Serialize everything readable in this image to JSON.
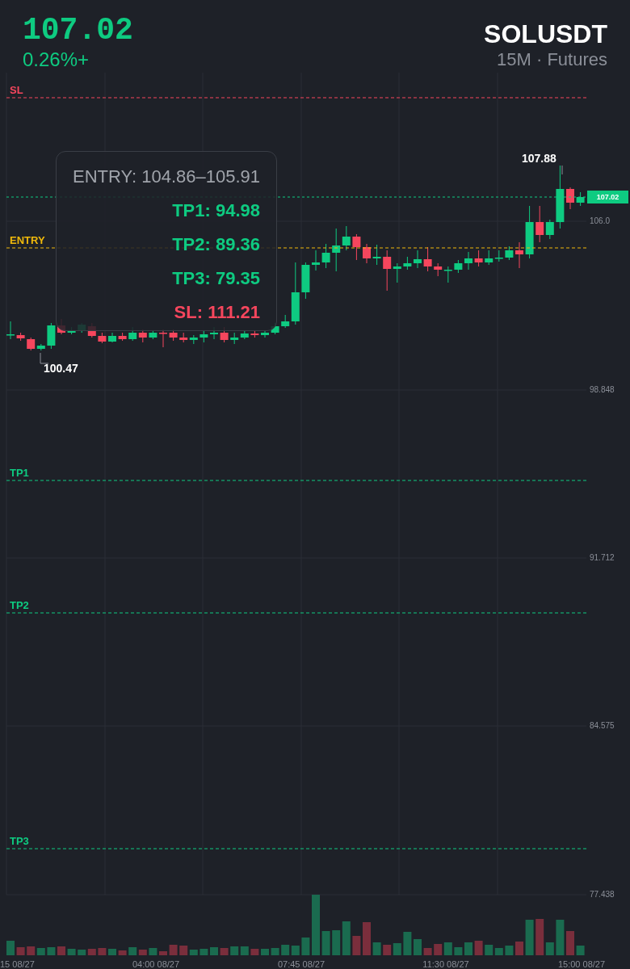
{
  "header": {
    "price": "107.02",
    "change": "0.26%+",
    "symbol": "SOLUSDT",
    "timeframe": "15M · Futures"
  },
  "levels": [
    {
      "label": "SL",
      "kind": "sl"
    },
    {
      "label": "ENTRY",
      "kind": "entry"
    },
    {
      "label": "TP1",
      "kind": "tp"
    },
    {
      "label": "TP2",
      "kind": "tp"
    },
    {
      "label": "TP3",
      "kind": "tp"
    }
  ],
  "tooltip": {
    "entry": "ENTRY: 104.86–105.91",
    "targets": [
      {
        "text": "TP1: 94.98",
        "kind": "tp"
      },
      {
        "text": "TP2: 89.36",
        "kind": "tp"
      },
      {
        "text": "TP3: 79.35",
        "kind": "tp"
      },
      {
        "text": "SL: 111.21",
        "kind": "sl"
      }
    ]
  },
  "high_label": "107.88",
  "low_label": "100.47",
  "current_price_tag": "107.02",
  "price_axis": [
    "106.0",
    "98.848",
    "91.712",
    "84.575",
    "77.438"
  ],
  "time_axis": [
    "15 08/27",
    "04:00 08/27",
    "07:45 08/27",
    "11:30 08/27",
    "15:00 08/27"
  ]
}
